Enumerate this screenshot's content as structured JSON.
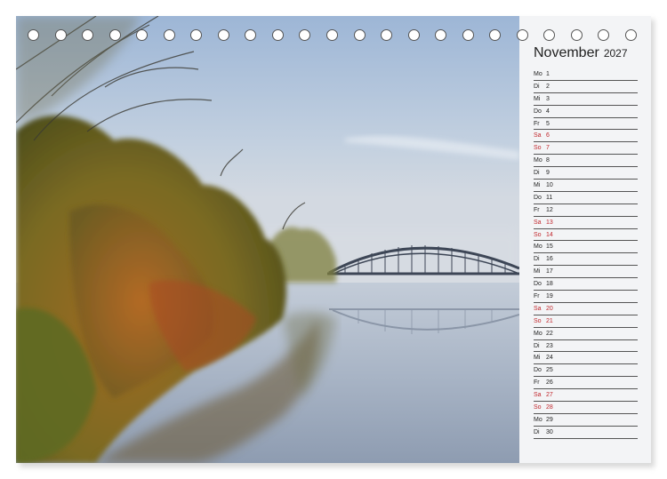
{
  "calendar": {
    "month": "November",
    "year": "2027",
    "days": [
      {
        "wd": "Mo",
        "d": "1",
        "weekend": false
      },
      {
        "wd": "Di",
        "d": "2",
        "weekend": false
      },
      {
        "wd": "Mi",
        "d": "3",
        "weekend": false
      },
      {
        "wd": "Do",
        "d": "4",
        "weekend": false
      },
      {
        "wd": "Fr",
        "d": "5",
        "weekend": false
      },
      {
        "wd": "Sa",
        "d": "6",
        "weekend": true
      },
      {
        "wd": "So",
        "d": "7",
        "weekend": true
      },
      {
        "wd": "Mo",
        "d": "8",
        "weekend": false
      },
      {
        "wd": "Di",
        "d": "9",
        "weekend": false
      },
      {
        "wd": "Mi",
        "d": "10",
        "weekend": false
      },
      {
        "wd": "Do",
        "d": "11",
        "weekend": false
      },
      {
        "wd": "Fr",
        "d": "12",
        "weekend": false
      },
      {
        "wd": "Sa",
        "d": "13",
        "weekend": true
      },
      {
        "wd": "So",
        "d": "14",
        "weekend": true
      },
      {
        "wd": "Mo",
        "d": "15",
        "weekend": false
      },
      {
        "wd": "Di",
        "d": "16",
        "weekend": false
      },
      {
        "wd": "Mi",
        "d": "17",
        "weekend": false
      },
      {
        "wd": "Do",
        "d": "18",
        "weekend": false
      },
      {
        "wd": "Fr",
        "d": "19",
        "weekend": false
      },
      {
        "wd": "Sa",
        "d": "20",
        "weekend": true
      },
      {
        "wd": "So",
        "d": "21",
        "weekend": true
      },
      {
        "wd": "Mo",
        "d": "22",
        "weekend": false
      },
      {
        "wd": "Di",
        "d": "23",
        "weekend": false
      },
      {
        "wd": "Mi",
        "d": "24",
        "weekend": false
      },
      {
        "wd": "Do",
        "d": "25",
        "weekend": false
      },
      {
        "wd": "Fr",
        "d": "26",
        "weekend": false
      },
      {
        "wd": "Sa",
        "d": "27",
        "weekend": true
      },
      {
        "wd": "So",
        "d": "28",
        "weekend": true
      },
      {
        "wd": "Mo",
        "d": "29",
        "weekend": false
      },
      {
        "wd": "Di",
        "d": "30",
        "weekend": false
      }
    ]
  },
  "binding": {
    "hole_count": 23
  },
  "colors": {
    "weekend": "#c1272d",
    "text": "#222222",
    "panel": "#f3f4f6"
  }
}
